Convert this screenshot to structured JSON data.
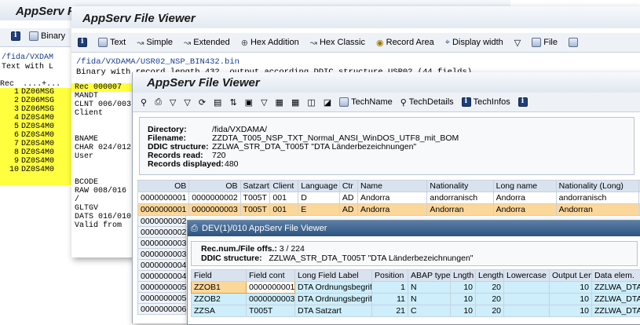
{
  "w1": {
    "title": "AppServ File Viewer",
    "toolbar_binary": "Binary",
    "path": "/fida/VXDAM",
    "path2": "Text with L",
    "rec_header": "Rec",
    "rec_ruler": "....+...",
    "records": [
      {
        "n": "1",
        "v": "DZ06MSG"
      },
      {
        "n": "2",
        "v": "DZ06MSG"
      },
      {
        "n": "3",
        "v": "DZ06MSG"
      },
      {
        "n": "4",
        "v": "DZ0S4M0"
      },
      {
        "n": "5",
        "v": "DZ0S4M0"
      },
      {
        "n": "6",
        "v": "DZ0S4M0"
      },
      {
        "n": "7",
        "v": "DZ0S4M0"
      },
      {
        "n": "8",
        "v": "DZ0S4M0"
      },
      {
        "n": "9",
        "v": "DZ0S4M0"
      },
      {
        "n": "10",
        "v": "DZ0S4M0"
      }
    ]
  },
  "w2": {
    "title": "AppServ File Viewer",
    "toolbar": [
      "Text",
      "Simple",
      "Extended",
      "Hex Addition",
      "Hex Classic",
      "Record Area",
      "Display width",
      "File"
    ],
    "path_line1": "/fida/VXDAMA/USR02_NSP_BIN432.bin",
    "path_line2": "Binary with record length 432, output according DDIC structure USR02 (44 fields)",
    "left_panel": [
      "Rec  000007",
      "MANDT",
      "CLNT 006/003",
      "Client",
      "",
      "",
      "BNAME",
      "CHAR 024/012",
      "User",
      "",
      "",
      "BCODE",
      "RAW  008/016",
      "/",
      "GLTGV",
      "DATS 016/010",
      "Valid from"
    ]
  },
  "w3": {
    "title": "AppServ File Viewer",
    "toolbar": [
      "TechName",
      "TechDetails",
      "TechInfos"
    ],
    "info": {
      "directory_label": "Directory:",
      "directory": "/fida/VXDAMA/",
      "filename_label": "Filename:",
      "filename": "ZZDTA_T005_NSP_TXT_Normal_ANSI_WinDOS_UTF8_mit_BOM",
      "ddic_label": "DDIC structure:",
      "ddic": "ZZLWA_STR_DTA_T005T \"DTA Länderbezeichnungen\"",
      "read_label": "Records read:",
      "read": "720",
      "displayed_label": "Records displayed:",
      "displayed": "480"
    },
    "headers": [
      "OB",
      "OB",
      "Satzart",
      "Client",
      "Language",
      "Ctr",
      "Name",
      "Nationality",
      "Long name",
      "Nationality (Long)",
      "S"
    ],
    "rows": [
      [
        "0000000001",
        "0000000002",
        "T005T",
        "001",
        "D",
        "AD",
        "Andorra",
        "andorranisch",
        "Andorra",
        "andorranisch"
      ],
      [
        "0000000001",
        "0000000003",
        "T005T",
        "001",
        "E",
        "AD",
        "Andorra",
        "Andorran",
        "Andorra",
        "Andorran"
      ]
    ],
    "ob_more": [
      "0000000002",
      "0000000002",
      "0000000003",
      "0000000003",
      "0000000004",
      "0000000004",
      "0000000005",
      "0000000005",
      "0000000006"
    ]
  },
  "w4": {
    "titlebar": "DEV(1)/010 AppServ File Viewer",
    "recnum_label": "Rec.num./File offs.:",
    "recnum": "3 / 224",
    "ddic_label": "DDIC structure:",
    "ddic": "ZZLWA_STR_DTA_T005T \"DTA Länderbezeichnungen\"",
    "headers": [
      "Field",
      "Field cont",
      "Long Field Label",
      "Position",
      "ABAP type",
      "Lngth",
      "Length",
      "Lowercase",
      "Output Len",
      "Data elem."
    ],
    "rows": [
      [
        "ZZOB1",
        "0000000001",
        "DTA Ordnungsbegriff",
        "1",
        "N",
        "10",
        "20",
        "",
        "10",
        "ZZLWA_DTA_OB"
      ],
      [
        "ZZOB2",
        "0000000003",
        "DTA Ordnungsbegriff",
        "11",
        "N",
        "10",
        "20",
        "",
        "10",
        "ZZLWA_DTA_OB"
      ],
      [
        "ZZSA",
        "T005T",
        "DTA Satzart",
        "21",
        "C",
        "10",
        "20",
        "",
        "10",
        "ZZLWA_DTA_SA"
      ]
    ]
  }
}
